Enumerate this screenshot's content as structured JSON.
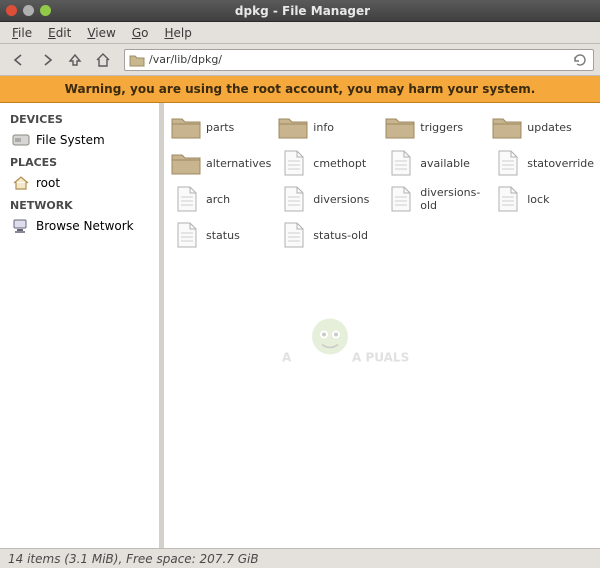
{
  "window": {
    "title": "dpkg - File Manager"
  },
  "menu": {
    "file": "File",
    "edit": "Edit",
    "view": "View",
    "go": "Go",
    "help": "Help"
  },
  "toolbar": {
    "path": "/var/lib/dpkg/"
  },
  "warning": "Warning, you are using the root account, you may harm your system.",
  "sidebar": {
    "devices": {
      "head": "DEVICES",
      "filesystem": "File System"
    },
    "places": {
      "head": "PLACES",
      "root": "root"
    },
    "network": {
      "head": "NETWORK",
      "browse": "Browse Network"
    }
  },
  "items": [
    {
      "label": "parts",
      "type": "folder"
    },
    {
      "label": "info",
      "type": "folder"
    },
    {
      "label": "triggers",
      "type": "folder"
    },
    {
      "label": "updates",
      "type": "folder"
    },
    {
      "label": "alternatives",
      "type": "folder"
    },
    {
      "label": "cmethopt",
      "type": "file"
    },
    {
      "label": "available",
      "type": "file"
    },
    {
      "label": "statoverride",
      "type": "file"
    },
    {
      "label": "arch",
      "type": "file"
    },
    {
      "label": "diversions",
      "type": "file"
    },
    {
      "label": "diversions-old",
      "type": "file"
    },
    {
      "label": "lock",
      "type": "file"
    },
    {
      "label": "status",
      "type": "file"
    },
    {
      "label": "status-old",
      "type": "file"
    }
  ],
  "status": "14 items (3.1 MiB), Free space: 207.7 GiB",
  "watermark": "A   PUALS"
}
